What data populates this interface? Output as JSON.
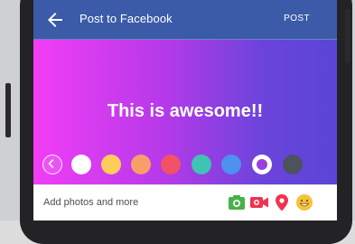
{
  "header": {
    "title": "Post to Facebook",
    "post_label": "POST",
    "bg_color": "#3b5ba8"
  },
  "canvas": {
    "text": "This is awesome!!",
    "gradient": [
      "#f23df5",
      "#b23ae9",
      "#6c44db",
      "#5a45d6"
    ]
  },
  "swatches": [
    {
      "name": "back",
      "color": ""
    },
    {
      "name": "white",
      "color": "#ffffff"
    },
    {
      "name": "yellow",
      "color": "#ffcd5b"
    },
    {
      "name": "orange",
      "color": "#f79f68"
    },
    {
      "name": "red",
      "color": "#f25268"
    },
    {
      "name": "teal",
      "color": "#3ec4b3"
    },
    {
      "name": "blue",
      "color": "#4c92ee"
    },
    {
      "name": "gradient-purple",
      "color": "#9a3fdf",
      "selected": true
    },
    {
      "name": "dark-gray",
      "color": "#4e525e"
    }
  ],
  "bottom_bar": {
    "label": "Add photos and more",
    "tools": [
      {
        "icon": "camera-icon",
        "color": "#49b149"
      },
      {
        "icon": "video-icon",
        "color": "#f0334f"
      },
      {
        "icon": "location-pin-icon",
        "color": "#f0334f"
      },
      {
        "icon": "smiley-icon",
        "color": "#f5c33b"
      }
    ]
  }
}
